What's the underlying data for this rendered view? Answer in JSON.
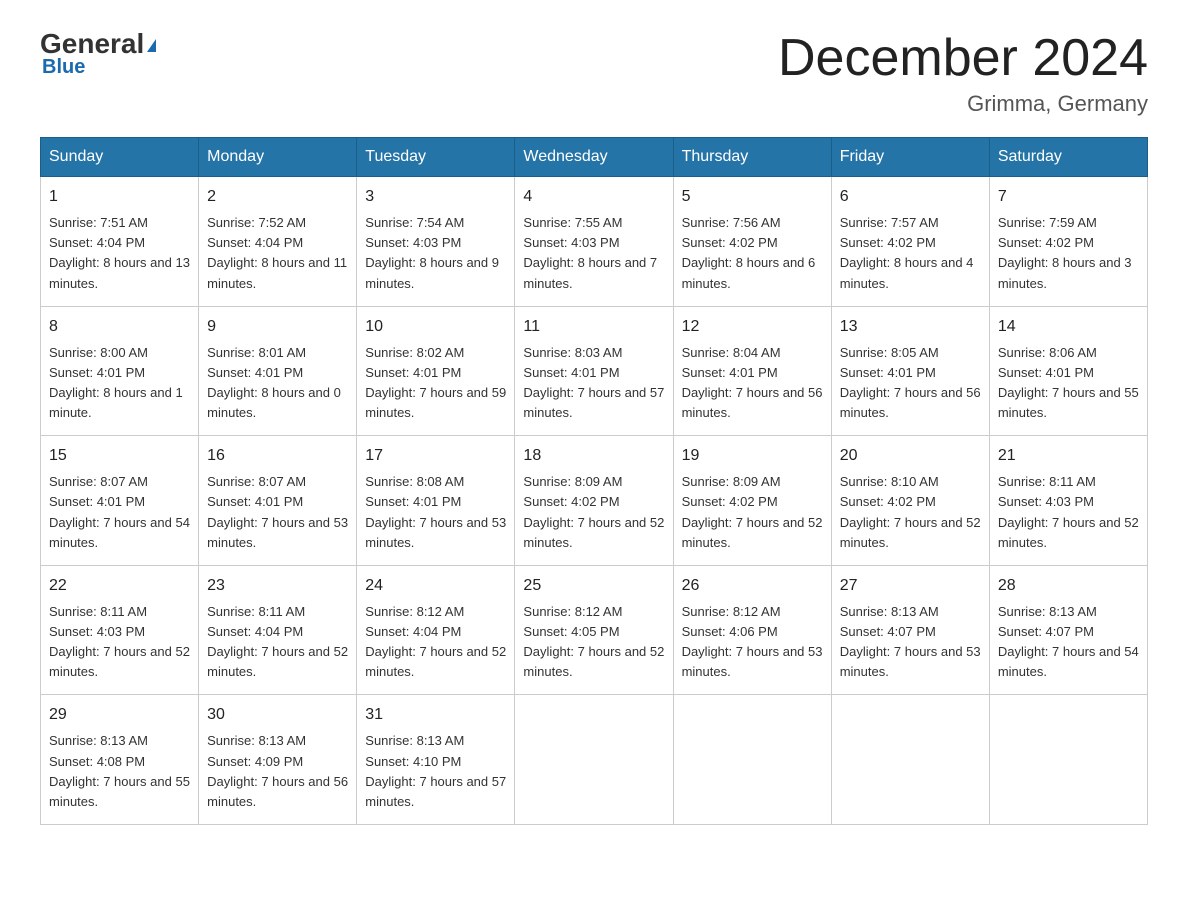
{
  "header": {
    "logo": {
      "general": "General",
      "triangle_color": "#1a6aad",
      "blue": "Blue"
    },
    "title": "December 2024",
    "location": "Grimma, Germany"
  },
  "calendar": {
    "days_of_week": [
      "Sunday",
      "Monday",
      "Tuesday",
      "Wednesday",
      "Thursday",
      "Friday",
      "Saturday"
    ],
    "weeks": [
      [
        {
          "num": "1",
          "sunrise": "7:51 AM",
          "sunset": "4:04 PM",
          "daylight": "8 hours and 13 minutes."
        },
        {
          "num": "2",
          "sunrise": "7:52 AM",
          "sunset": "4:04 PM",
          "daylight": "8 hours and 11 minutes."
        },
        {
          "num": "3",
          "sunrise": "7:54 AM",
          "sunset": "4:03 PM",
          "daylight": "8 hours and 9 minutes."
        },
        {
          "num": "4",
          "sunrise": "7:55 AM",
          "sunset": "4:03 PM",
          "daylight": "8 hours and 7 minutes."
        },
        {
          "num": "5",
          "sunrise": "7:56 AM",
          "sunset": "4:02 PM",
          "daylight": "8 hours and 6 minutes."
        },
        {
          "num": "6",
          "sunrise": "7:57 AM",
          "sunset": "4:02 PM",
          "daylight": "8 hours and 4 minutes."
        },
        {
          "num": "7",
          "sunrise": "7:59 AM",
          "sunset": "4:02 PM",
          "daylight": "8 hours and 3 minutes."
        }
      ],
      [
        {
          "num": "8",
          "sunrise": "8:00 AM",
          "sunset": "4:01 PM",
          "daylight": "8 hours and 1 minute."
        },
        {
          "num": "9",
          "sunrise": "8:01 AM",
          "sunset": "4:01 PM",
          "daylight": "8 hours and 0 minutes."
        },
        {
          "num": "10",
          "sunrise": "8:02 AM",
          "sunset": "4:01 PM",
          "daylight": "7 hours and 59 minutes."
        },
        {
          "num": "11",
          "sunrise": "8:03 AM",
          "sunset": "4:01 PM",
          "daylight": "7 hours and 57 minutes."
        },
        {
          "num": "12",
          "sunrise": "8:04 AM",
          "sunset": "4:01 PM",
          "daylight": "7 hours and 56 minutes."
        },
        {
          "num": "13",
          "sunrise": "8:05 AM",
          "sunset": "4:01 PM",
          "daylight": "7 hours and 56 minutes."
        },
        {
          "num": "14",
          "sunrise": "8:06 AM",
          "sunset": "4:01 PM",
          "daylight": "7 hours and 55 minutes."
        }
      ],
      [
        {
          "num": "15",
          "sunrise": "8:07 AM",
          "sunset": "4:01 PM",
          "daylight": "7 hours and 54 minutes."
        },
        {
          "num": "16",
          "sunrise": "8:07 AM",
          "sunset": "4:01 PM",
          "daylight": "7 hours and 53 minutes."
        },
        {
          "num": "17",
          "sunrise": "8:08 AM",
          "sunset": "4:01 PM",
          "daylight": "7 hours and 53 minutes."
        },
        {
          "num": "18",
          "sunrise": "8:09 AM",
          "sunset": "4:02 PM",
          "daylight": "7 hours and 52 minutes."
        },
        {
          "num": "19",
          "sunrise": "8:09 AM",
          "sunset": "4:02 PM",
          "daylight": "7 hours and 52 minutes."
        },
        {
          "num": "20",
          "sunrise": "8:10 AM",
          "sunset": "4:02 PM",
          "daylight": "7 hours and 52 minutes."
        },
        {
          "num": "21",
          "sunrise": "8:11 AM",
          "sunset": "4:03 PM",
          "daylight": "7 hours and 52 minutes."
        }
      ],
      [
        {
          "num": "22",
          "sunrise": "8:11 AM",
          "sunset": "4:03 PM",
          "daylight": "7 hours and 52 minutes."
        },
        {
          "num": "23",
          "sunrise": "8:11 AM",
          "sunset": "4:04 PM",
          "daylight": "7 hours and 52 minutes."
        },
        {
          "num": "24",
          "sunrise": "8:12 AM",
          "sunset": "4:04 PM",
          "daylight": "7 hours and 52 minutes."
        },
        {
          "num": "25",
          "sunrise": "8:12 AM",
          "sunset": "4:05 PM",
          "daylight": "7 hours and 52 minutes."
        },
        {
          "num": "26",
          "sunrise": "8:12 AM",
          "sunset": "4:06 PM",
          "daylight": "7 hours and 53 minutes."
        },
        {
          "num": "27",
          "sunrise": "8:13 AM",
          "sunset": "4:07 PM",
          "daylight": "7 hours and 53 minutes."
        },
        {
          "num": "28",
          "sunrise": "8:13 AM",
          "sunset": "4:07 PM",
          "daylight": "7 hours and 54 minutes."
        }
      ],
      [
        {
          "num": "29",
          "sunrise": "8:13 AM",
          "sunset": "4:08 PM",
          "daylight": "7 hours and 55 minutes."
        },
        {
          "num": "30",
          "sunrise": "8:13 AM",
          "sunset": "4:09 PM",
          "daylight": "7 hours and 56 minutes."
        },
        {
          "num": "31",
          "sunrise": "8:13 AM",
          "sunset": "4:10 PM",
          "daylight": "7 hours and 57 minutes."
        },
        null,
        null,
        null,
        null
      ]
    ],
    "sunrise_label": "Sunrise:",
    "sunset_label": "Sunset:",
    "daylight_label": "Daylight:"
  }
}
